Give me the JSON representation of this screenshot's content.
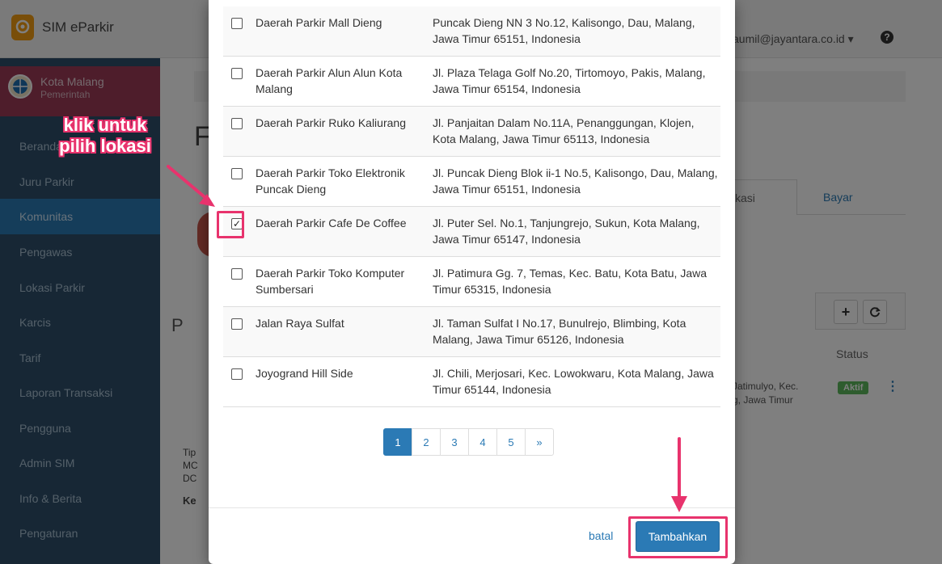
{
  "app": {
    "name": "SIM eParkir",
    "user_email": "aumil@jayantara.co.id",
    "user_caret": "▾",
    "help_glyph": "?"
  },
  "sidebar": {
    "org_name": "Kota Malang",
    "org_type": "Pemerintah",
    "items": [
      {
        "label": "Beranda"
      },
      {
        "label": "Juru Parkir"
      },
      {
        "label": "Komunitas"
      },
      {
        "label": "Pengawas"
      },
      {
        "label": "Lokasi Parkir"
      },
      {
        "label": "Karcis"
      },
      {
        "label": "Tarif"
      },
      {
        "label": "Laporan Transaksi"
      },
      {
        "label": "Pengguna"
      },
      {
        "label": "Admin SIM"
      },
      {
        "label": "Info & Berita"
      },
      {
        "label": "Pengaturan"
      }
    ],
    "active_index": 2
  },
  "background": {
    "page_title_letter": "F",
    "tabs": [
      "kasi",
      "Bayar"
    ],
    "section_letter": "P",
    "status_header": "Status",
    "row_address": "Jatimulyo, Kec.\ng, Jawa Timur",
    "status_badge": "Aktif",
    "tip_text": "Tip\nMC\nDC",
    "ke_text": "Ke"
  },
  "modal": {
    "locations": [
      {
        "name": "Daerah Parkir Mall Dieng",
        "address": "Puncak Dieng NN 3 No.12, Kalisongo, Dau, Malang, Jawa Timur 65151, Indonesia",
        "checked": false
      },
      {
        "name": "Daerah Parkir Alun Alun Kota Malang",
        "address": "Jl. Plaza Telaga Golf No.20, Tirtomoyo, Pakis, Malang, Jawa Timur 65154, Indonesia",
        "checked": false
      },
      {
        "name": "Daerah Parkir Ruko Kaliurang",
        "address": "Jl. Panjaitan Dalam No.11A, Penanggungan, Klojen, Kota Malang, Jawa Timur 65113, Indonesia",
        "checked": false
      },
      {
        "name": "Daerah Parkir Toko Elektronik Puncak Dieng",
        "address": "Jl. Puncak Dieng Blok ii-1 No.5, Kalisongo, Dau, Malang, Jawa Timur 65151, Indonesia",
        "checked": false
      },
      {
        "name": "Daerah Parkir Cafe De Coffee",
        "address": "Jl. Puter Sel. No.1, Tanjungrejo, Sukun, Kota Malang, Jawa Timur 65147, Indonesia",
        "checked": true
      },
      {
        "name": "Daerah Parkir Toko Komputer Sumbersari",
        "address": "Jl. Patimura Gg. 7, Temas, Kec. Batu, Kota Batu, Jawa Timur 65315, Indonesia",
        "checked": false
      },
      {
        "name": "Jalan Raya Sulfat",
        "address": "Jl. Taman Sulfat I No.17, Bunulrejo, Blimbing, Kota Malang, Jawa Timur 65126, Indonesia",
        "checked": false
      },
      {
        "name": "Joyogrand Hill Side",
        "address": "Jl. Chili, Merjosari, Kec. Lowokwaru, Kota Malang, Jawa Timur 65144, Indonesia",
        "checked": false
      }
    ],
    "pagination": {
      "pages": [
        "1",
        "2",
        "3",
        "4",
        "5",
        "»"
      ],
      "current": 1
    },
    "cancel_label": "batal",
    "submit_label": "Tambahkan"
  },
  "annotation": {
    "callout_text": "klik untuk pilih lokasi",
    "color": "#e8336d"
  }
}
